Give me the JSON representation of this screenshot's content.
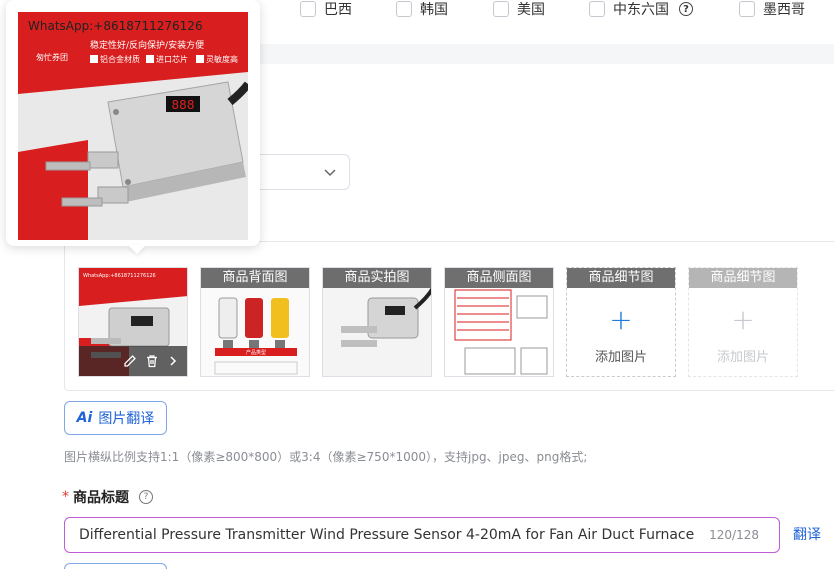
{
  "countries": [
    {
      "label": "巴西"
    },
    {
      "label": "韩国"
    },
    {
      "label": "美国"
    },
    {
      "label": "中东六国",
      "help": "?"
    },
    {
      "label": "墨西哥"
    }
  ],
  "popover": {
    "whatsapp": "WhatsApp:+8618711276126",
    "features_line1": "稳定性好/反向保护/安装方便",
    "features_line2": "铝合金材质",
    "features_line3": "进口芯片",
    "features_line4": "灵敏度高",
    "brand": "匆忙券团",
    "display": "888"
  },
  "image_tiles": [
    {
      "kind": "main",
      "whatsapp": "WhatsApp:+8618711276126"
    },
    {
      "kind": "back",
      "label": "商品背面图",
      "caption": "产品类型"
    },
    {
      "kind": "real",
      "label": "商品实拍图"
    },
    {
      "kind": "side",
      "label": "商品侧面图"
    },
    {
      "kind": "add",
      "label": "商品细节图",
      "add_text": "添加图片",
      "plus": "+"
    },
    {
      "kind": "add_disabled",
      "label": "商品细节图",
      "add_text": "添加图片",
      "plus": "+"
    }
  ],
  "translate_button": {
    "ai": "Ai",
    "label": "图片翻译"
  },
  "hint": "图片横纵比例支持1:1（像素≥800*800）或3:4（像素≥750*1000），支持jpg、jpeg、png格式;",
  "title_field": {
    "required_mark": "*",
    "label": "商品标题",
    "help": "?",
    "value": "Differential Pressure Transmitter Wind Pressure Sensor 4-20mA for Fan Air Duct Furnace Negative Pressure",
    "count": "120/128",
    "translate_link": "翻译"
  },
  "colors": {
    "accent": "#1f63d8",
    "product_red": "#d81e1e",
    "input_focus": "#c05cd8"
  },
  "icons": {
    "select": "chevron-down-icon",
    "tile_tools": [
      "edit-icon",
      "trash-icon",
      "chevron-right-icon"
    ]
  }
}
